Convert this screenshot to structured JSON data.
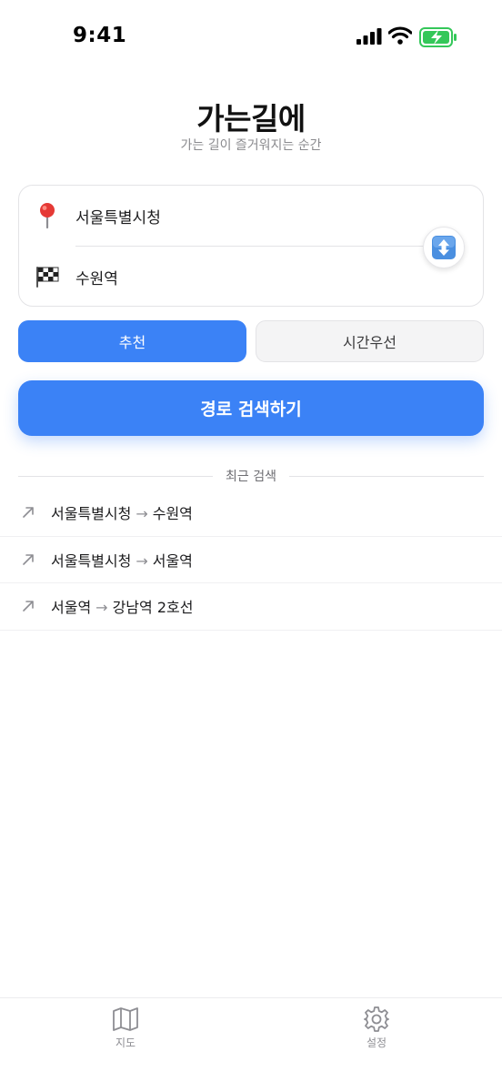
{
  "status_bar": {
    "time": "9:41"
  },
  "header": {
    "title": "가는길에",
    "subtitle": "가는 길이 즐거워지는 순간"
  },
  "route": {
    "origin": "서울특별시청",
    "destination": "수원역",
    "origin_icon": "pin-icon",
    "destination_icon": "checkered-flag-icon"
  },
  "modes": {
    "items": [
      {
        "label": "추천",
        "selected": true
      },
      {
        "label": "시간우선",
        "selected": false
      }
    ]
  },
  "search_button": {
    "label": "경로 검색하기"
  },
  "recent": {
    "title": "최근 검색",
    "items": [
      {
        "from": "서울특별시청",
        "to": "수원역"
      },
      {
        "from": "서울특별시청",
        "to": "서울역"
      },
      {
        "from": "서울역",
        "to": "강남역 2호선"
      }
    ]
  },
  "tab_bar": {
    "tabs": [
      {
        "label": "지도",
        "icon": "map-icon"
      },
      {
        "label": "설정",
        "icon": "gear-icon"
      }
    ]
  },
  "colors": {
    "accent": "#3b82f6",
    "battery": "#34c759"
  }
}
